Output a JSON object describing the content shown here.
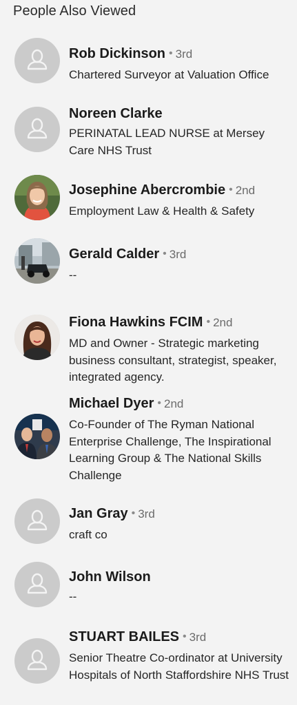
{
  "section": {
    "title": "People Also Viewed"
  },
  "people": [
    {
      "name": "Rob Dickinson",
      "degree": "3rd",
      "headline": "Chartered Surveyor at Valuation Office",
      "avatar": "placeholder-icon"
    },
    {
      "name": "Noreen Clarke",
      "degree": "",
      "headline": "PERINATAL LEAD NURSE at Mersey Care NHS Trust",
      "avatar": "placeholder-icon"
    },
    {
      "name": "Josephine Abercrombie",
      "degree": "2nd",
      "headline": "Employment Law & Health & Safety",
      "avatar": "photo"
    },
    {
      "name": "Gerald Calder",
      "degree": "3rd",
      "headline": "--",
      "avatar": "photo"
    },
    {
      "name": "Fiona Hawkins FCIM",
      "degree": "2nd",
      "headline": "MD and Owner - Strategic marketing business consultant, strategist, speaker, integrated agency.",
      "avatar": "photo"
    },
    {
      "name": "Michael Dyer",
      "degree": "2nd",
      "headline": "Co-Founder of The Ryman National Enterprise Challenge, The Inspirational Learning Group & The National Skills Challenge",
      "avatar": "photo"
    },
    {
      "name": "Jan Gray",
      "degree": "3rd",
      "headline": "craft co",
      "avatar": "placeholder-icon"
    },
    {
      "name": "John Wilson",
      "degree": "",
      "headline": "--",
      "avatar": "placeholder-icon"
    },
    {
      "name": "STUART BAILES",
      "degree": "3rd",
      "headline": "Senior Theatre Co-ordinator at University Hospitals of North Staffordshire NHS Trust",
      "avatar": "placeholder-icon"
    }
  ]
}
